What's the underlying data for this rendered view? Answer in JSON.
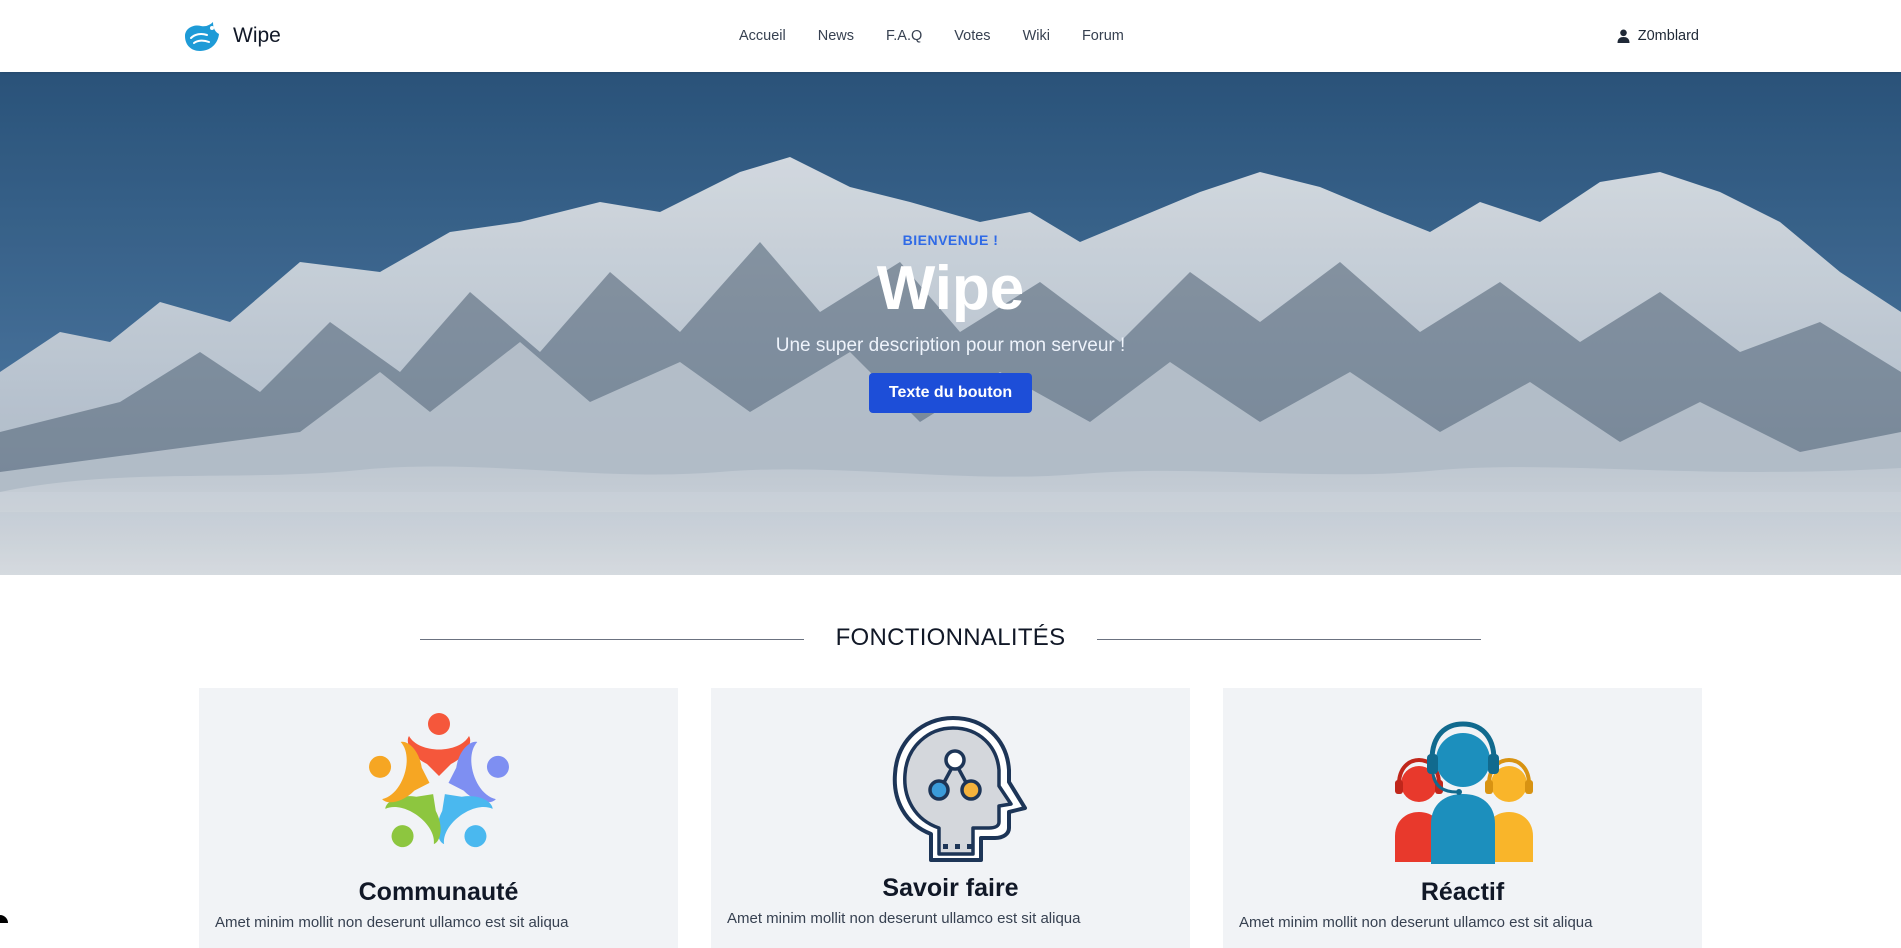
{
  "site": {
    "name": "Wipe"
  },
  "nav": {
    "links": [
      "Accueil",
      "News",
      "F.A.Q",
      "Votes",
      "Wiki",
      "Forum"
    ],
    "user": "Z0mblard",
    "user_icon": "user-icon"
  },
  "hero": {
    "eyebrow": "BIENVENUE !",
    "title": "Wipe",
    "description": "Une super description pour mon serveur !",
    "button": "Texte du bouton"
  },
  "features": {
    "title": "FONCTIONNALITÉS",
    "cards": [
      {
        "title": "Communauté",
        "icon": "community-icon",
        "text": "Amet minim mollit non deserunt ullamco est sit aliqua"
      },
      {
        "title": "Savoir faire",
        "icon": "knowledge-head-icon",
        "text": "Amet minim mollit non deserunt ullamco est sit aliqua"
      },
      {
        "title": "Réactif",
        "icon": "support-team-icon",
        "text": "Amet minim mollit non deserunt ullamco est sit aliqua"
      }
    ]
  },
  "colors": {
    "accent": "#1d4ed8",
    "eyebrow": "#2f6ae6",
    "card_bg": "#f1f3f6"
  }
}
